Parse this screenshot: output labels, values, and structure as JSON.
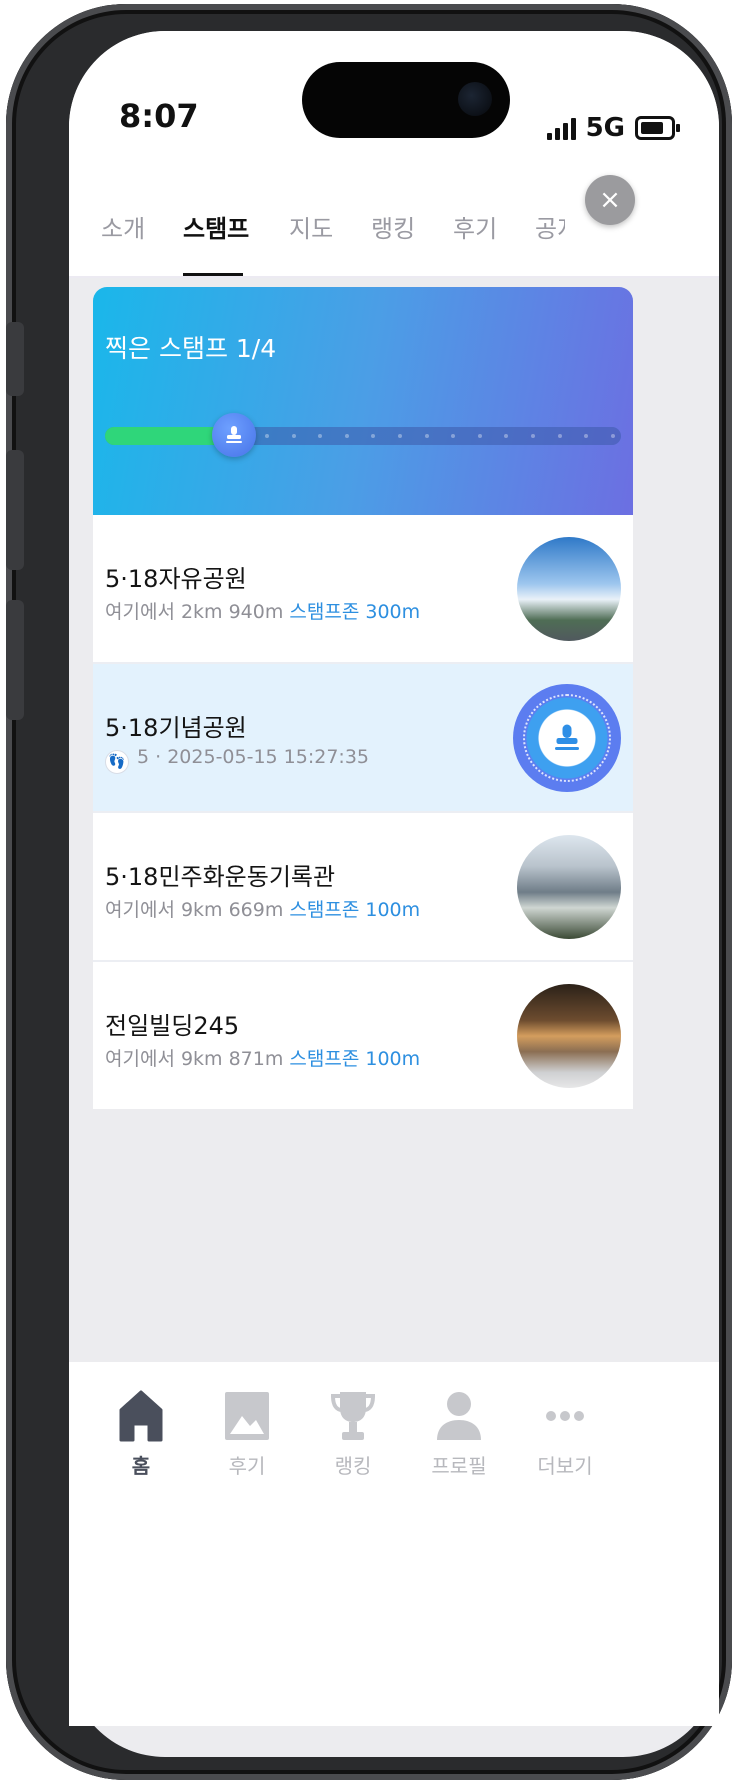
{
  "status_bar": {
    "time": "8:07",
    "network": "5G"
  },
  "tabs": [
    {
      "label": "소개"
    },
    {
      "label": "스탬프"
    },
    {
      "label": "지도"
    },
    {
      "label": "랭킹"
    },
    {
      "label": "후기"
    },
    {
      "label": "공지"
    }
  ],
  "active_tab": "스탬프",
  "close_label": "×",
  "stamp_card": {
    "title": "찍은 스탬프 1/4",
    "collected": 1,
    "total": 4,
    "progress_fraction": 0.25
  },
  "places": [
    {
      "name": "5·18자유공원",
      "distance_prefix": "여기에서 2km 940m",
      "zone": "스탬프존 300m",
      "image": "park-photo"
    },
    {
      "name": "5·18기념공원",
      "visit_count": "5",
      "visit_time": "· 2025-05-15 15:27:35",
      "image": "stamp-icon"
    },
    {
      "name": "5·18민주화운동기록관",
      "distance_prefix": "여기에서 9km 669m",
      "zone": "스탬프존 100m",
      "image": "museum-photo"
    },
    {
      "name": "전일빌딩245",
      "distance_prefix": "여기에서 9km 871m",
      "zone": "스탬프존 100m",
      "image": "building-photo"
    }
  ],
  "bottom_nav": [
    {
      "label": "홈",
      "icon": "home-icon",
      "active": true
    },
    {
      "label": "후기",
      "icon": "image-icon",
      "active": false
    },
    {
      "label": "랭킹",
      "icon": "trophy-icon",
      "active": false
    },
    {
      "label": "프로필",
      "icon": "profile-icon",
      "active": false
    },
    {
      "label": "더보기",
      "icon": "more-icon",
      "active": false
    }
  ],
  "colors": {
    "accent": "#2d8fe0",
    "progress": "#2fd67a",
    "hero_start": "#1ab7ea",
    "hero_end": "#6c6fe2",
    "collected_row": "#e3f2fd"
  }
}
